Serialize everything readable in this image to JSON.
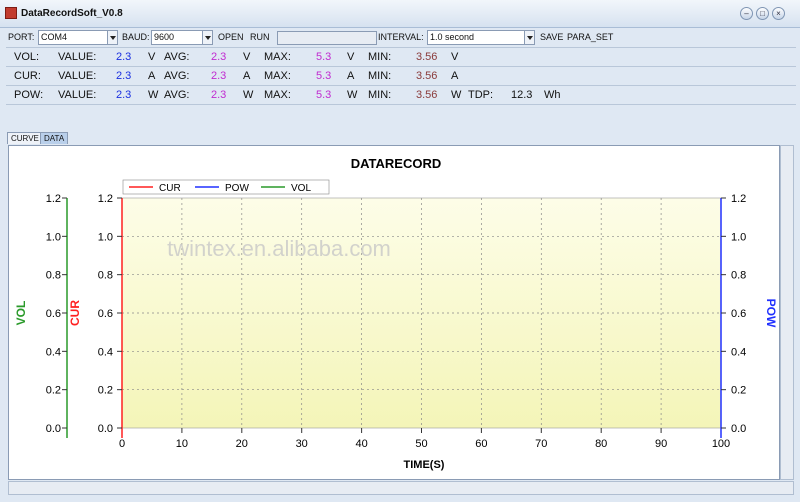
{
  "window": {
    "title": "DataRecordSoft_V0.8"
  },
  "toolbar": {
    "port_label": "PORT:",
    "port_value": "COM4",
    "baud_label": "BAUD:",
    "baud_value": "9600",
    "open_label": "OPEN",
    "run_label": "RUN",
    "interval_label": "INTERVAL:",
    "interval_value": "1.0 second",
    "save_label": "SAVE",
    "para_set_label": "PARA_SET"
  },
  "readings": [
    {
      "name": "VOL:",
      "value_label": "VALUE:",
      "value": "2.3",
      "unit": "V",
      "avg_label": "AVG:",
      "avg": "2.3",
      "max_label": "MAX:",
      "max": "5.3",
      "min_label": "MIN:",
      "min": "3.56"
    },
    {
      "name": "CUR:",
      "value_label": "VALUE:",
      "value": "2.3",
      "unit": "A",
      "avg_label": "AVG:",
      "avg": "2.3",
      "max_label": "MAX:",
      "max": "5.3",
      "min_label": "MIN:",
      "min": "3.56"
    },
    {
      "name": "POW:",
      "value_label": "VALUE:",
      "value": "2.3",
      "unit": "W",
      "avg_label": "AVG:",
      "avg": "2.3",
      "max_label": "MAX:",
      "max": "5.3",
      "min_label": "MIN:",
      "min": "3.56",
      "tdp_label": "TDP:",
      "tdp": "12.3",
      "tdp_unit": "Wh"
    }
  ],
  "tabs": [
    "CURVE",
    "DATA"
  ],
  "watermark": "twintex.en.alibaba.com",
  "colors": {
    "cur": "#ff2020",
    "pow": "#2030ff",
    "vol": "#2a9a2a",
    "plot_bg_top": "#fdfde8",
    "plot_bg_bottom": "#f4f5b8"
  },
  "chart_data": {
    "type": "line",
    "title": "DATARECORD",
    "xlabel": "TIME(S)",
    "xlim": [
      0,
      100
    ],
    "x_ticks": [
      "0",
      "10",
      "20",
      "30",
      "40",
      "50",
      "60",
      "70",
      "80",
      "90",
      "100"
    ],
    "y_ticks": [
      "0.0",
      "0.2",
      "0.4",
      "0.6",
      "0.8",
      "1.0",
      "1.2"
    ],
    "axes": [
      {
        "label": "VOL",
        "side": "left-outer",
        "ylim": [
          0,
          1.2
        ],
        "color": "#2a9a2a"
      },
      {
        "label": "CUR",
        "side": "left-inner",
        "ylim": [
          0,
          1.2
        ],
        "color": "#ff2020"
      },
      {
        "label": "POW",
        "side": "right",
        "ylim": [
          0,
          1.2
        ],
        "color": "#2030ff"
      }
    ],
    "legend": [
      "CUR",
      "POW",
      "VOL"
    ],
    "legend_position": "top-left",
    "grid": true,
    "series": []
  }
}
